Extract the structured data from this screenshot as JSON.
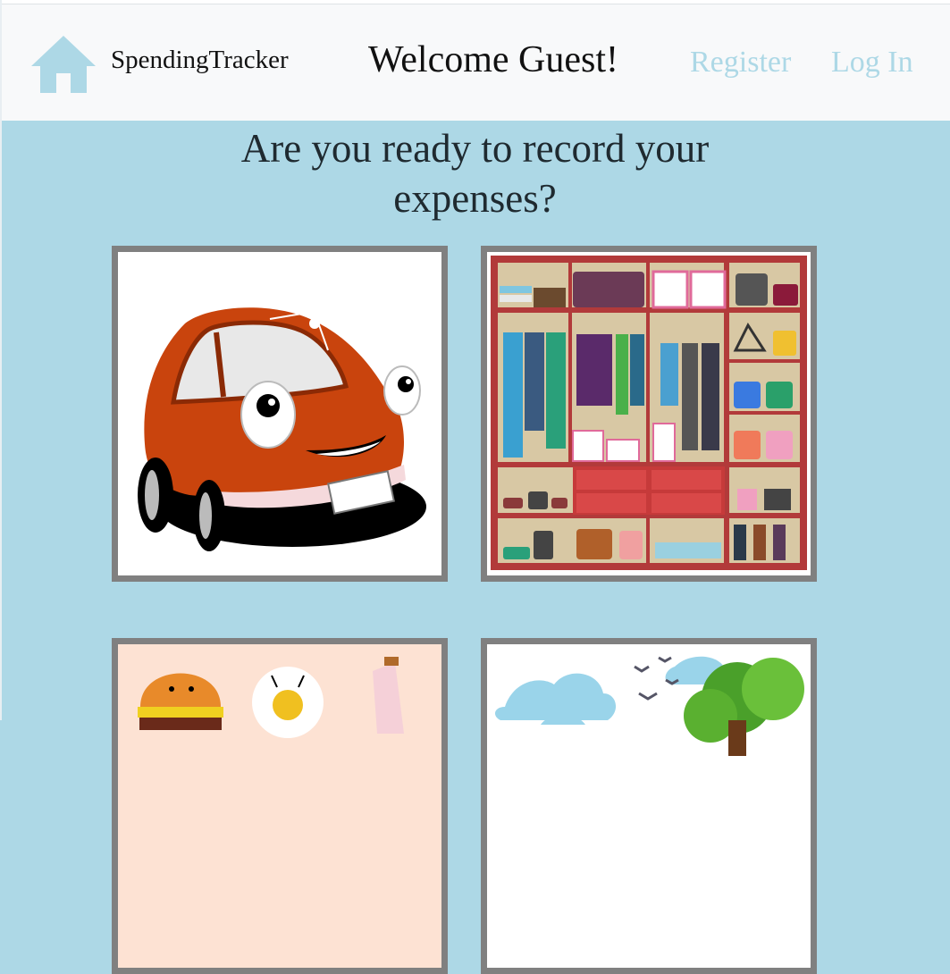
{
  "navbar": {
    "brand": "SpendingTracker",
    "welcome": "Welcome Guest!",
    "links": {
      "register": "Register",
      "login": "Log In"
    },
    "link_color": "#add8e6",
    "home_icon": "home-icon"
  },
  "main": {
    "headline_line1": "Are you ready to record your",
    "headline_line2": "expenses?",
    "background": "#add8e6",
    "categories": [
      {
        "icon": "car-icon"
      },
      {
        "icon": "wardrobe-icon"
      },
      {
        "icon": "food-icon"
      },
      {
        "icon": "nature-icon"
      }
    ]
  }
}
